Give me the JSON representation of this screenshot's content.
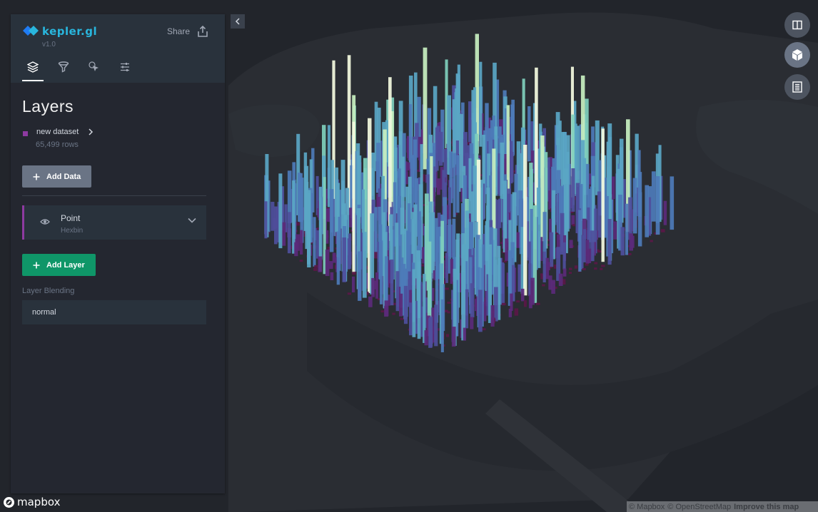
{
  "app": {
    "name": "kepler.gl",
    "version": "v1.0",
    "share_label": "Share"
  },
  "tabs": [
    {
      "id": "layers",
      "icon": "layers-icon",
      "active": true
    },
    {
      "id": "filters",
      "icon": "filter-icon",
      "active": false
    },
    {
      "id": "interactions",
      "icon": "cursor-icon",
      "active": false
    },
    {
      "id": "basemap",
      "icon": "sliders-icon",
      "active": false
    }
  ],
  "panel": {
    "title": "Layers",
    "dataset": {
      "name": "new dataset",
      "rows": "65,499 rows",
      "color": "#8e3aa1"
    },
    "add_data_label": "Add Data",
    "layer": {
      "name": "Point",
      "type": "Hexbin",
      "visible": true
    },
    "add_layer_label": "Add Layer",
    "blending_label": "Layer Blending",
    "blending_value": "normal"
  },
  "map_controls": [
    {
      "icon": "split-map-icon",
      "active": false
    },
    {
      "icon": "3d-cube-icon",
      "active": true
    },
    {
      "icon": "legend-icon",
      "active": false
    }
  ],
  "attribution": {
    "mapbox": "© Mapbox",
    "osm": "© OpenStreetMap",
    "improve": "Improve this map",
    "logo_text": "mapbox"
  },
  "colors": {
    "accent": "#29b6dd",
    "panel_bg": "#242730",
    "panel_header": "#29323c",
    "add_layer": "#0f9668",
    "hexbin_ramp": [
      "#5a1846",
      "#5b2a7a",
      "#4e4f9c",
      "#4d7bb8",
      "#5aa6c4",
      "#7fcfbc",
      "#c8f0c0",
      "#f4fbe0"
    ]
  }
}
